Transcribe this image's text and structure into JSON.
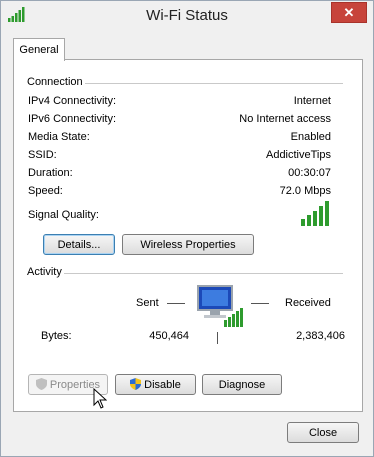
{
  "window": {
    "title": "Wi-Fi Status",
    "close_glyph": "✕"
  },
  "tabs": [
    {
      "label": "General"
    }
  ],
  "connection": {
    "heading": "Connection",
    "rows": [
      {
        "label": "IPv4 Connectivity:",
        "value": "Internet"
      },
      {
        "label": "IPv6 Connectivity:",
        "value": "No Internet access"
      },
      {
        "label": "Media State:",
        "value": "Enabled"
      },
      {
        "label": "SSID:",
        "value": "AddictiveTips"
      },
      {
        "label": "Duration:",
        "value": "00:30:07"
      },
      {
        "label": "Speed:",
        "value": "72.0 Mbps"
      }
    ],
    "signal_label": "Signal Quality:",
    "signal_bars": 5,
    "signal_max": 5,
    "details_button": "Details...",
    "wireless_button": "Wireless Properties"
  },
  "activity": {
    "heading": "Activity",
    "sent_label": "Sent",
    "received_label": "Received",
    "bytes_label": "Bytes:",
    "bytes_sent": "450,464",
    "bytes_received": "2,383,406",
    "icon": "network-computer-icon"
  },
  "actions": {
    "properties": "Properties",
    "disable": "Disable",
    "diagnose": "Diagnose"
  },
  "footer": {
    "close": "Close"
  },
  "colors": {
    "signal_green": "#2e9b2e",
    "close_red": "#c7443b"
  }
}
